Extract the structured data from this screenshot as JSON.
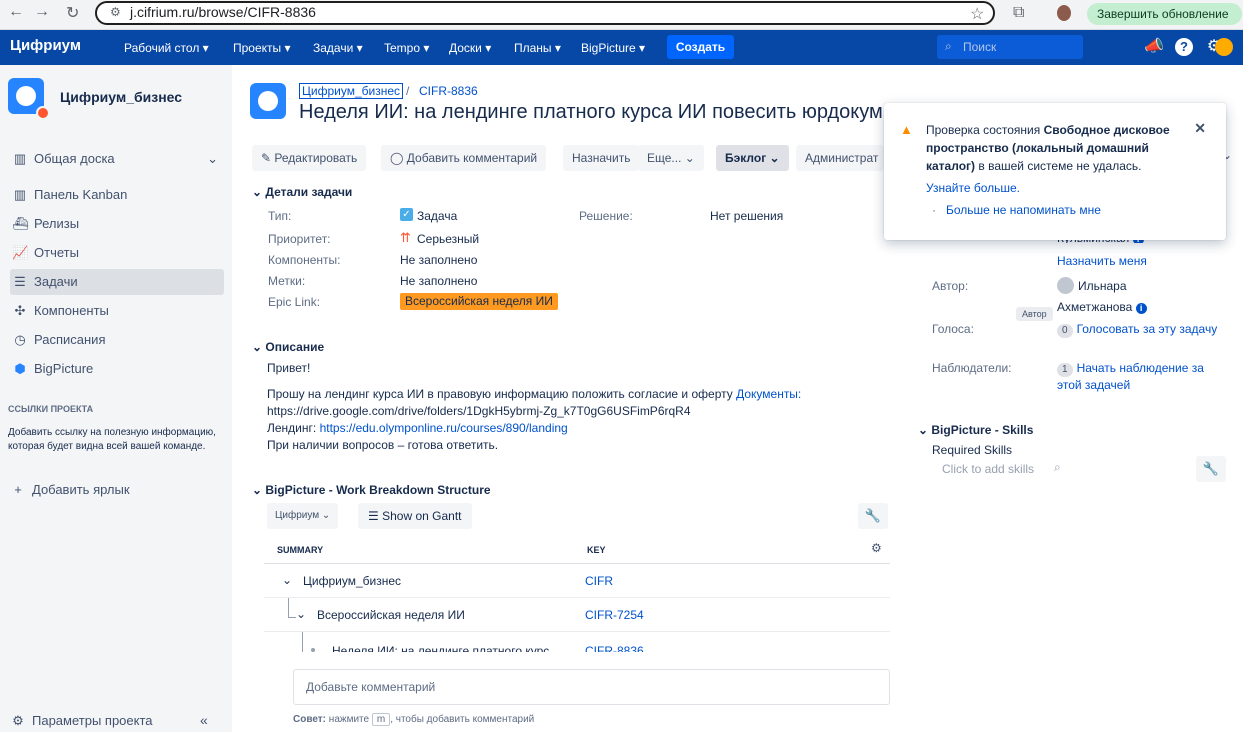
{
  "browser": {
    "url": "j.cifrium.ru/browse/CIFR-8836",
    "update_label": "Завершить обновление"
  },
  "header": {
    "logo": "Цифриум",
    "nav": [
      "Рабочий стол",
      "Проекты",
      "Задачи",
      "Tempo",
      "Доски",
      "Планы",
      "BigPicture"
    ],
    "create_label": "Создать",
    "search_placeholder": "Поиск"
  },
  "sidebar": {
    "project_name": "Цифриум_бизнес",
    "board_label": "Общая доска",
    "items": [
      {
        "label": "Панель Kanban",
        "icon": "kanban-icon"
      },
      {
        "label": "Релизы",
        "icon": "ship-icon"
      },
      {
        "label": "Отчеты",
        "icon": "chart-icon"
      },
      {
        "label": "Задачи",
        "icon": "tasks-icon"
      },
      {
        "label": "Компоненты",
        "icon": "puzzle-icon"
      },
      {
        "label": "Расписания",
        "icon": "clock-icon"
      },
      {
        "label": "BigPicture",
        "icon": "bigpicture-icon"
      }
    ],
    "links_title": "ССЫЛКИ ПРОЕКТА",
    "links_text": "Добавить ссылку на полезную информацию, которая будет видна всей вашей команде.",
    "add_label": "Добавить ярлык",
    "settings_label": "Параметры проекта"
  },
  "issue": {
    "project": "Цифриум_бизнес",
    "key": "CIFR-8836",
    "title": "Неделя ИИ: на лендинге платного курса ИИ повесить юрдокум",
    "toolbar": {
      "edit": "Редактировать",
      "comment": "Добавить комментарий",
      "assign": "Назначить",
      "more": "Еще...",
      "backlog": "Бэклог",
      "admin": "Администрат"
    },
    "details_title": "Детали задачи",
    "details": {
      "type_label": "Тип:",
      "type_value": "Задача",
      "priority_label": "Приоритет:",
      "priority_value": "Серьезный",
      "components_label": "Компоненты:",
      "components_value": "Не заполнено",
      "labels_label": "Метки:",
      "labels_value": "Не заполнено",
      "epic_label": "Epic Link:",
      "epic_value": "Всероссийская неделя ИИ",
      "resolution_label": "Решение:",
      "resolution_value": "Нет решения"
    },
    "description_title": "Описание",
    "description": {
      "greeting": "Привет!",
      "line1": "Прошу на лендинг курса ИИ в правовую информацию положить согласие и оферту",
      "docs_link_label": "Документы:",
      "docs_url": "https://drive.google.com/drive/folders/1DgkH5ybrmj-Zg_k7T0gG6USFimP6rqR4",
      "landing_label": "Лендинг:",
      "landing_url": "https://edu.olymponline.ru/courses/890/landing",
      "closing": "При наличии вопросов – готова ответить."
    }
  },
  "wbs": {
    "title": "BigPicture - Work Breakdown Structure",
    "dropdown": "Цифриум",
    "gantt_label": "Show on Gantt",
    "col_summary": "SUMMARY",
    "col_key": "KEY",
    "rows": [
      {
        "summary": "Цифриум_бизнес",
        "key": "CIFR"
      },
      {
        "summary": "Всероссийская неделя ИИ",
        "key": "CIFR-7254"
      },
      {
        "summary": "Неделя ИИ: на лендинге платного курс",
        "key": "CIFR-8836"
      }
    ]
  },
  "comment": {
    "placeholder": "Добавьте комментарий",
    "tip_bold": "Совет:",
    "tip_pre": "нажмите",
    "tip_key": "m",
    "tip_post": ", чтобы добавить комментарий"
  },
  "popup": {
    "line1_pre": "Проверка состояния ",
    "line1_bold": "Свободное дисковое",
    "line2_bold": "пространство (локальный домашний",
    "line3_bold": "каталог)",
    "line3_post": " в вашей системе не удалась.",
    "learn_more": "Узнайте больше.",
    "dont_remind": "Больше не напоминать мне"
  },
  "people": {
    "assignee_partial": "Кульминская",
    "assign_me": "Назначить меня",
    "author_label": "Автор:",
    "author_name_1": "Ильнара",
    "author_name_2": "Ахметжанова",
    "tooltip": "Автор",
    "votes_label": "Голоса:",
    "votes_count": "0",
    "votes_link": "Голосовать за эту задачу",
    "watchers_label": "Наблюдатели:",
    "watchers_count": "1",
    "watch_link_1": "Начать наблюдение за",
    "watch_link_2": "этой задачей"
  },
  "skills": {
    "title": "BigPicture - Skills",
    "required": "Required Skills",
    "placeholder": "Click to add skills"
  },
  "colors": {
    "brand": "#0747a6",
    "link": "#0052cc",
    "epic": "#ff991f",
    "warning": "#ff8b00"
  }
}
